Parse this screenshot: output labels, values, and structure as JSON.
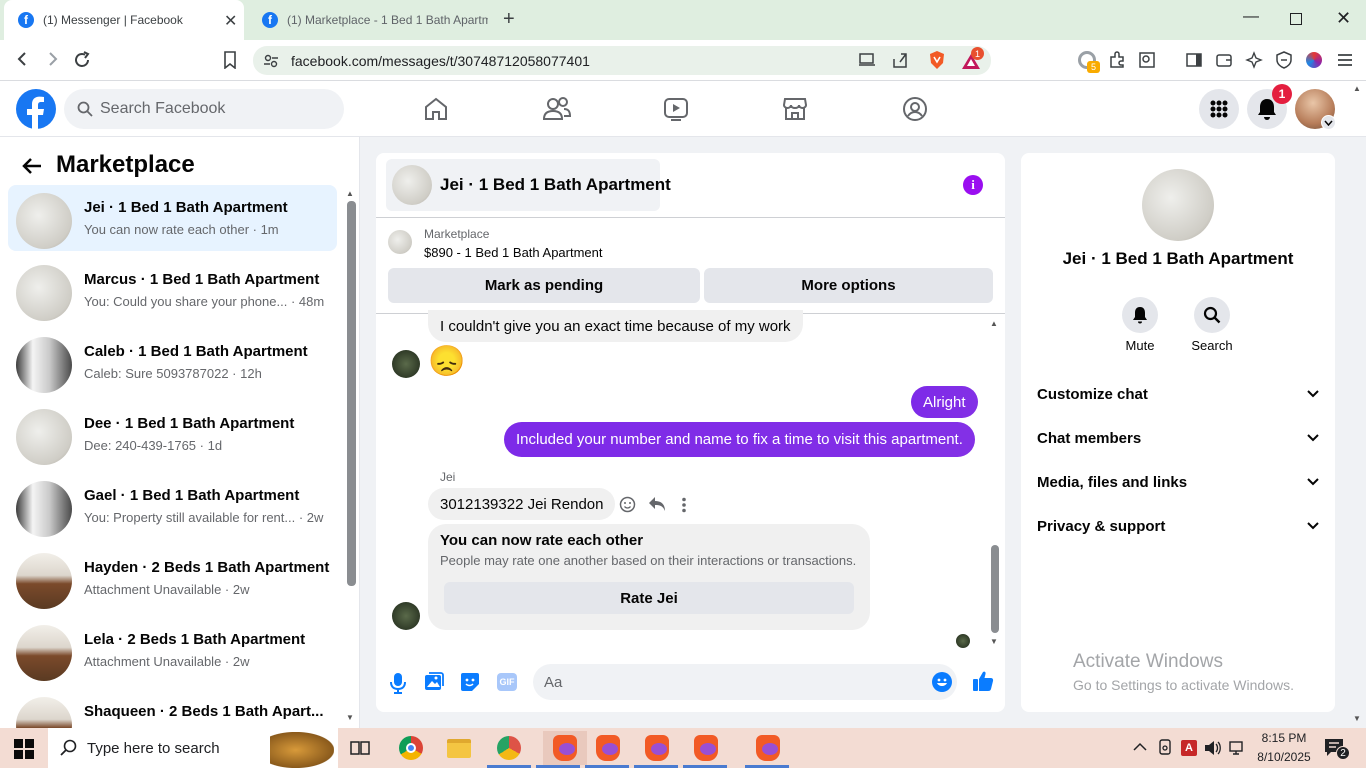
{
  "browser": {
    "tabs": [
      {
        "title": "(1) Messenger | Facebook"
      },
      {
        "title": "(1) Marketplace - 1 Bed 1 Bath Apartm"
      }
    ],
    "url": "facebook.com/messages/t/30748712058077401",
    "extension_badge_count": "5",
    "brave_rewards_badge": "1"
  },
  "facebook": {
    "search_placeholder": "Search Facebook",
    "notifications_count": "1"
  },
  "sidebar": {
    "title": "Marketplace",
    "conversations": [
      {
        "name": "Jei · 1 Bed 1 Bath Apartment",
        "preview": "You can now rate each other · 1m",
        "avatar": "wall",
        "selected": true
      },
      {
        "name": "Marcus · 1 Bed 1 Bath Apartment",
        "preview": "You: Could you share your phone... · 48m",
        "avatar": "wall"
      },
      {
        "name": "Caleb · 1 Bed 1 Bath Apartment",
        "preview": "Caleb: Sure 5093787022 · 12h",
        "avatar": "bath"
      },
      {
        "name": "Dee · 1 Bed 1 Bath Apartment",
        "preview": "Dee: 240-439-1765 · 1d",
        "avatar": "wall"
      },
      {
        "name": "Gael · 1 Bed 1 Bath Apartment",
        "preview": "You: Property still available for rent... · 2w",
        "avatar": "bath"
      },
      {
        "name": "Hayden · 2 Beds 1 Bath Apartment",
        "preview": "Attachment Unavailable · 2w",
        "avatar": "kitchen"
      },
      {
        "name": "Lela · 2 Beds 1 Bath Apartment",
        "preview": "Attachment Unavailable · 2w",
        "avatar": "kitchen"
      },
      {
        "name": "Shaqueen · 2 Beds 1 Bath Apart...",
        "preview": "",
        "avatar": "kitchen"
      }
    ]
  },
  "chat": {
    "title": "Jei · 1 Bed 1 Bath Apartment",
    "listing_source": "Marketplace",
    "listing_title": "$890 - 1 Bed 1 Bath Apartment",
    "mark_pending": "Mark as pending",
    "more_options": "More options",
    "msg_incoming_1": "I couldn't give you an exact time because of my work",
    "msg_emoji": "😞",
    "msg_out_1": "Alright",
    "msg_out_2": "Included your number and name to fix a time to visit this apartment.",
    "sender_label": "Jei",
    "msg_incoming_2": "3012139322 Jei Rendon",
    "rate_title": "You can now rate each other",
    "rate_sub": "People may rate one another based on their interactions or transactions.",
    "rate_button": "Rate Jei",
    "composer_placeholder": "Aa",
    "gif_label": "GIF"
  },
  "info_panel": {
    "name": "Jei · 1 Bed 1 Bath Apartment",
    "mute_label": "Mute",
    "search_label": "Search",
    "sections": [
      "Customize chat",
      "Chat members",
      "Media, files and links",
      "Privacy & support"
    ]
  },
  "watermark": {
    "title": "Activate Windows",
    "subtitle": "Go to Settings to activate Windows."
  },
  "taskbar": {
    "search_placeholder": "Type here to search",
    "time": "8:15 PM",
    "date": "8/10/2025",
    "notification_count": "2"
  },
  "colors": {
    "fb_blue": "#1877f2",
    "messenger_purple": "#7b2ff7",
    "red_badge": "#e41e3f"
  }
}
